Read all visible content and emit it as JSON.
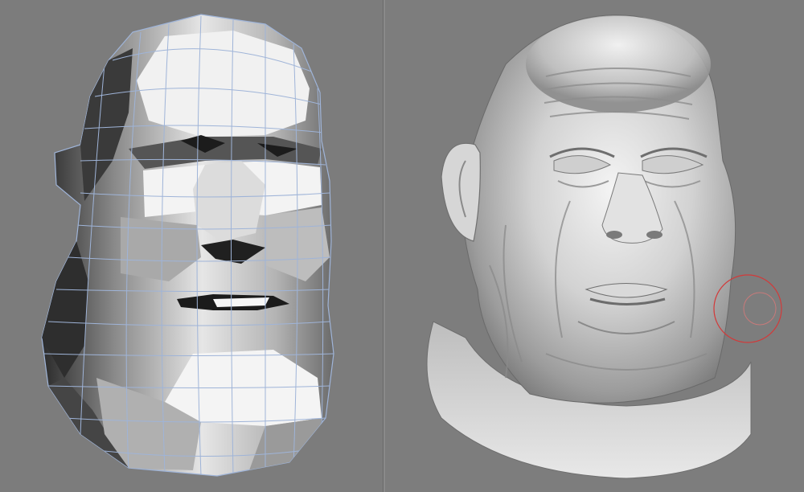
{
  "viewports": [
    {
      "id": "left",
      "kind": "low-poly wireframe head",
      "label": ""
    },
    {
      "id": "right",
      "kind": "high-detail sculpted head",
      "label": ""
    }
  ],
  "brush_cursor_color": "#d23a3a",
  "wire_color": "#9fb4d8",
  "background_color": "#7d7d7d"
}
